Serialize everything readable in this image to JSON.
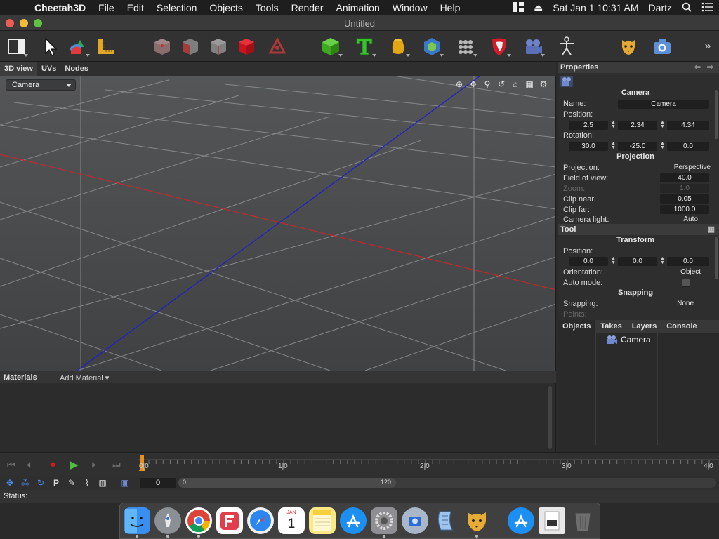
{
  "menubar": {
    "app": "Cheetah3D",
    "items": [
      "File",
      "Edit",
      "Selection",
      "Objects",
      "Tools",
      "Render",
      "Animation",
      "Window",
      "Help"
    ],
    "clock": "Sat Jan 1  10:31 AM",
    "user": "Dartz"
  },
  "window": {
    "title": "Untitled"
  },
  "toolbar": {
    "icons": [
      "view-layout-icon",
      "pointer-tool-icon",
      "move-tool-icon",
      "ruler-tool-icon",
      "cube-outline-icon",
      "cube-faces-icon",
      "cube-edges-icon",
      "cube-red-icon",
      "vertex-tool-icon",
      "cube-primitive-icon",
      "text-object-icon",
      "vase-lathe-icon",
      "polygon-object-icon",
      "spheres-array-icon",
      "shield-icon",
      "camera-object-icon",
      "character-joint-icon",
      "cheetah-render-icon",
      "camera-render-icon",
      "more-chevron-icon"
    ],
    "overflow": "»"
  },
  "view_tabs": [
    "3D view",
    "UVs",
    "Nodes"
  ],
  "viewport": {
    "camera_select": "Camera",
    "tools": [
      "⊕",
      "✥",
      "⚲",
      "↺",
      "⌂",
      "▦",
      "⚙"
    ],
    "colors": {
      "x_axis": "#c0282c",
      "z_axis": "#2020c8",
      "grid": "#8f9294"
    }
  },
  "materials": {
    "label": "Materials",
    "add_label": "Add Material ▾"
  },
  "properties": {
    "header": "Properties",
    "camera_section": "Camera",
    "name_label": "Name:",
    "name_value": "Camera",
    "position_label": "Position:",
    "position": [
      "2.5",
      "2.34",
      "4.34"
    ],
    "rotation_label": "Rotation:",
    "rotation": [
      "30.0",
      "-25.0",
      "0.0"
    ],
    "projection_section": "Projection",
    "projection_label": "Projection:",
    "projection_value": "Perspective",
    "fov_label": "Field of view:",
    "fov_value": "40.0",
    "zoom_label": "Zoom:",
    "zoom_value": "1.0",
    "clip_near_label": "Clip near:",
    "clip_near_value": "0.05",
    "clip_far_label": "Clip far:",
    "clip_far_value": "1000.0",
    "camera_light_label": "Camera light:",
    "camera_light_value": "Auto"
  },
  "tool": {
    "header": "Tool",
    "transform_section": "Transform",
    "position_label": "Position:",
    "position": [
      "0.0",
      "0.0",
      "0.0"
    ],
    "orientation_label": "Orientation:",
    "orientation_value": "Object",
    "auto_mode_label": "Auto mode:",
    "snapping_section": "Snapping",
    "snapping_label": "Snapping:",
    "snapping_value": "None",
    "points_label": "Points:"
  },
  "objects_panel": {
    "tabs": [
      "Objects",
      "Takes",
      "Layers",
      "Console"
    ],
    "items": [
      "Camera"
    ]
  },
  "timeline": {
    "ticks": [
      "0",
      "1",
      "2",
      "3",
      "4"
    ],
    "tick_subs": [
      "0",
      "0",
      "0",
      "0",
      "0"
    ],
    "current_frame": "0",
    "range_start": "0",
    "range_end": "120"
  },
  "status": {
    "label": "Status:"
  },
  "dock": {
    "apps": [
      "finder-icon",
      "launchpad-icon",
      "chrome-icon",
      "fantastical-icon",
      "safari-icon",
      "calendar-icon",
      "notes-icon",
      "app-store-icon",
      "system-preferences-icon",
      "screenshot-icon",
      "script-editor-icon",
      "cheetah3d-icon",
      "app-store-downloads-icon",
      "documents-icon",
      "trash-icon"
    ],
    "calendar": {
      "month": "JAN",
      "day": "1"
    }
  }
}
